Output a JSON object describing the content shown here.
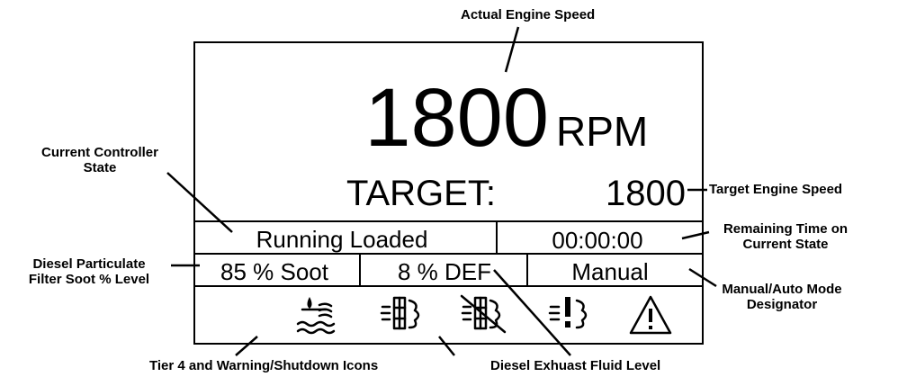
{
  "display": {
    "engine_speed": "1800",
    "speed_unit": "RPM",
    "target_label": "TARGET:",
    "target_value": "1800",
    "controller_state": "Running Loaded",
    "remaining_time": "00:00:00",
    "soot_level": "85 % Soot",
    "def_level": "8 % DEF",
    "mode": "Manual",
    "icons": [
      "coolant-level-icon",
      "dpf-regen-icon",
      "dpf-regen-inhibit-icon",
      "dpf-warning-icon",
      "warning-triangle-icon"
    ]
  },
  "callouts": {
    "actual_engine_speed": "Actual Engine Speed",
    "current_controller_state": [
      "Current Controller",
      "State"
    ],
    "target_engine_speed": "Target Engine Speed",
    "remaining_time": [
      "Remaining Time on",
      "Current State"
    ],
    "dpf_soot": [
      "Diesel Particulate",
      "Filter Soot % Level"
    ],
    "mode_designator": [
      "Manual/Auto Mode",
      "Designator"
    ],
    "tier4_icons": "Tier 4 and Warning/Shutdown Icons",
    "def_level": "Diesel Exhuast Fluid Level"
  }
}
